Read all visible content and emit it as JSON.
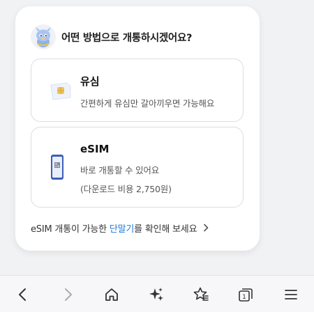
{
  "question": "어떤 방법으로 개통하시겠어요?",
  "options": [
    {
      "title": "유심",
      "desc": [
        "간편하게 유심만 갈아끼우면 가능해요"
      ]
    },
    {
      "title": "eSIM",
      "desc": [
        "바로 개통할 수 있어요",
        "(다운로드 비용 2,750원)"
      ]
    }
  ],
  "footer": {
    "prefix": "eSIM 개통이 가능한 ",
    "highlight": "단말기",
    "suffix": "를 확인해 보세요"
  },
  "colors": {
    "accent": "#1e78d6",
    "background": "#f1f2f4",
    "card": "#ffffff"
  },
  "toolbar": {
    "icons": [
      "back-arrow-icon",
      "forward-arrow-icon",
      "home-icon",
      "sparkle-icon",
      "favorites-star-icon",
      "tabs-icon",
      "menu-icon"
    ],
    "tab_count": "1"
  }
}
